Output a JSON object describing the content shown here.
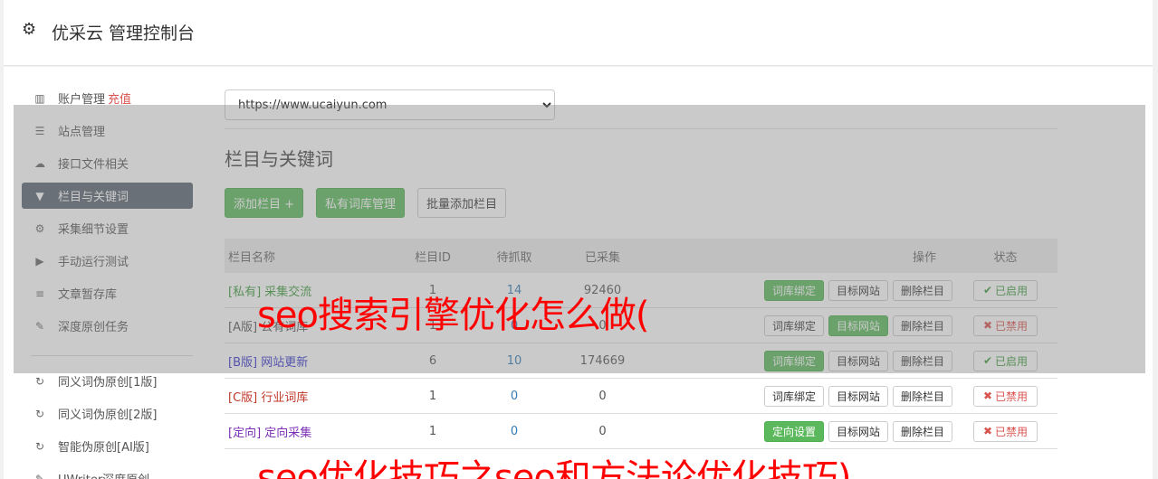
{
  "header": {
    "title": "优采云 管理控制台",
    "icon": "gear-icon"
  },
  "sidebar": {
    "items": [
      {
        "label": "账户管理",
        "extra": "充值",
        "icon": "bar-chart-icon"
      },
      {
        "label": "站点管理",
        "icon": "server-icon"
      },
      {
        "label": "接口文件相关",
        "icon": "cloud-upload-icon"
      },
      {
        "label": "栏目与关键词",
        "icon": "filter-icon",
        "active": true
      },
      {
        "label": "采集细节设置",
        "icon": "gears-icon"
      },
      {
        "label": "手动运行测试",
        "icon": "play-circle-icon"
      },
      {
        "label": "文章暂存库",
        "icon": "database-icon"
      },
      {
        "label": "深度原创任务",
        "icon": "edit-icon"
      }
    ],
    "items2": [
      {
        "label": "同义词伪原创[1版]",
        "icon": "refresh-icon"
      },
      {
        "label": "同义词伪原创[2版]",
        "icon": "refresh-icon"
      },
      {
        "label": "智能伪原创[AI版]",
        "icon": "refresh-icon"
      },
      {
        "label": "UWriter深度原创",
        "icon": "edit-icon"
      }
    ]
  },
  "main": {
    "site_select": "https://www.ucaiyun.com",
    "section_title": "栏目与关键词",
    "buttons": {
      "add": "添加栏目 +",
      "private": "私有词库管理",
      "batch": "批量添加栏目"
    },
    "columns": [
      "栏目名称",
      "栏目ID",
      "待抓取",
      "已采集",
      "操作",
      "状态"
    ],
    "rows": [
      {
        "tag": "[私有]",
        "name": "采集交流",
        "tag_color": "#3c9b3c",
        "id": "1",
        "pending": "14",
        "collected": "92460",
        "op1": "词库绑定",
        "op1_green": true,
        "op2": "目标网站",
        "op2_green": false,
        "op3": "删除栏目",
        "status": "已启用",
        "status_on": true
      },
      {
        "tag": "[A版]",
        "name": "公有词库",
        "tag_color": "#555555",
        "id": "1",
        "pending": "0",
        "collected": "0",
        "op1": "词库绑定",
        "op1_green": false,
        "op2": "目标网站",
        "op2_green": true,
        "op3": "删除栏目",
        "status": "已禁用",
        "status_on": false
      },
      {
        "tag": "[B版]",
        "name": "网站更新",
        "tag_color": "#3333cc",
        "id": "6",
        "pending": "10",
        "collected": "174669",
        "op1": "词库绑定",
        "op1_green": true,
        "op2": "目标网站",
        "op2_green": false,
        "op3": "删除栏目",
        "status": "已启用",
        "status_on": true
      },
      {
        "tag": "[C版]",
        "name": "行业词库",
        "tag_color": "#c0392b",
        "id": "1",
        "pending": "0",
        "collected": "0",
        "op1": "词库绑定",
        "op1_green": false,
        "op2": "目标网站",
        "op2_green": false,
        "op3": "删除栏目",
        "status": "已禁用",
        "status_on": false
      },
      {
        "tag": "[定向]",
        "name": "定向采集",
        "tag_color": "#7b2fb5",
        "id": "1",
        "pending": "0",
        "collected": "0",
        "op1": "定向设置",
        "op1_green": true,
        "op2": "目标网站",
        "op2_green": false,
        "op3": "删除栏目",
        "status": "已禁用",
        "status_on": false
      }
    ]
  },
  "watermark": {
    "line1": "seo搜索引擎优化怎么做(",
    "line2": "seo优化技巧之seo和方法论优化技巧)"
  }
}
